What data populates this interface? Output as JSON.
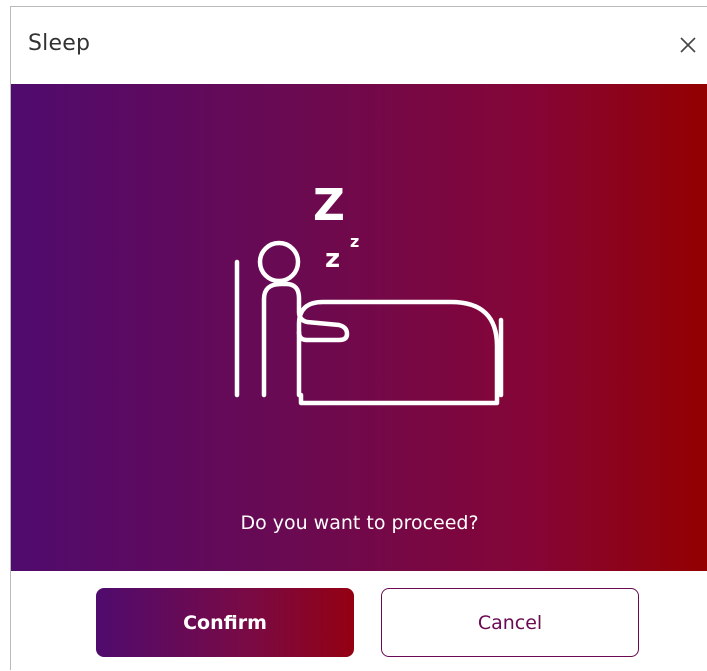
{
  "dialog": {
    "title": "Sleep",
    "close_icon": "close-icon",
    "prompt": "Do you want to proceed?",
    "illustration_icon": "sleeping-in-bed-icon",
    "confirm_label": "Confirm",
    "cancel_label": "Cancel",
    "colors": {
      "gradient_start": "#4f0b6e",
      "gradient_end": "#940000",
      "accent": "#6a0a52"
    }
  }
}
